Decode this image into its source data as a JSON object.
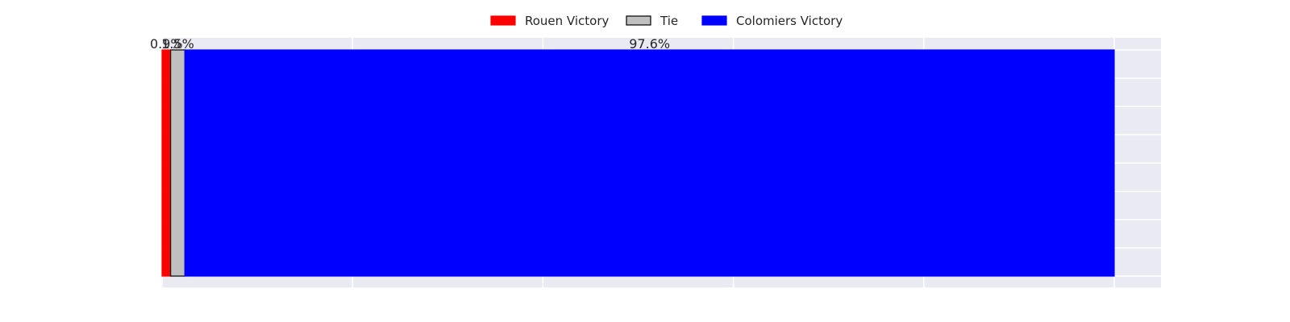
{
  "chart_data": {
    "type": "bar",
    "orientation": "horizontal",
    "stacked": true,
    "title": "",
    "xlabel": "",
    "ylabel": "",
    "xlim": [
      0,
      105
    ],
    "grid": true,
    "legend_position": "top-center",
    "series": [
      {
        "name": "Rouen Victory",
        "value": 0.9,
        "label": "0.9%",
        "color": "#ff0000",
        "edge": "#ff0000"
      },
      {
        "name": "Tie",
        "value": 1.5,
        "label": "1.5%",
        "color": "#c0c0c0",
        "edge": "#000000"
      },
      {
        "name": "Colomiers Victory",
        "value": 97.6,
        "label": "97.6%",
        "color": "#0000ff",
        "edge": "#0000ff"
      }
    ]
  }
}
